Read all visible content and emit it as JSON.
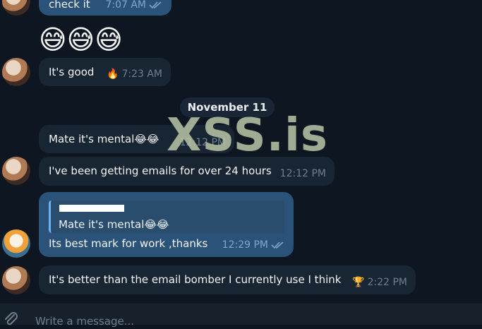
{
  "messages": [
    {
      "text": "check it",
      "time": "7:07 AM"
    },
    {
      "emoji": "😅😅😅"
    },
    {
      "text": "It's good",
      "reaction": "🔥",
      "time": "7:23 AM"
    },
    {
      "text": "Mate it's mental😂😂",
      "time": "12:12 PM"
    },
    {
      "text": "I've been getting emails for over 24 hours",
      "time": "12:12 PM"
    },
    {
      "reply_text": "Mate it's mental😂😂",
      "text": "Its best mark for work ,thanks",
      "time": "12:29 PM"
    },
    {
      "text": "It's better than the email bomber I currently use I think",
      "reaction": "🏆",
      "time": "2:22 PM"
    }
  ],
  "date_separator": "November 11",
  "watermark": "XSS.is",
  "composer": {
    "placeholder": "Write a message..."
  },
  "icons": {
    "attach": "paperclip-icon",
    "read": "double-check-icon"
  },
  "colors": {
    "background": "#0e1621",
    "incoming": "#182533",
    "outgoing": "#2b5278",
    "accent": "#6ab3f3"
  }
}
